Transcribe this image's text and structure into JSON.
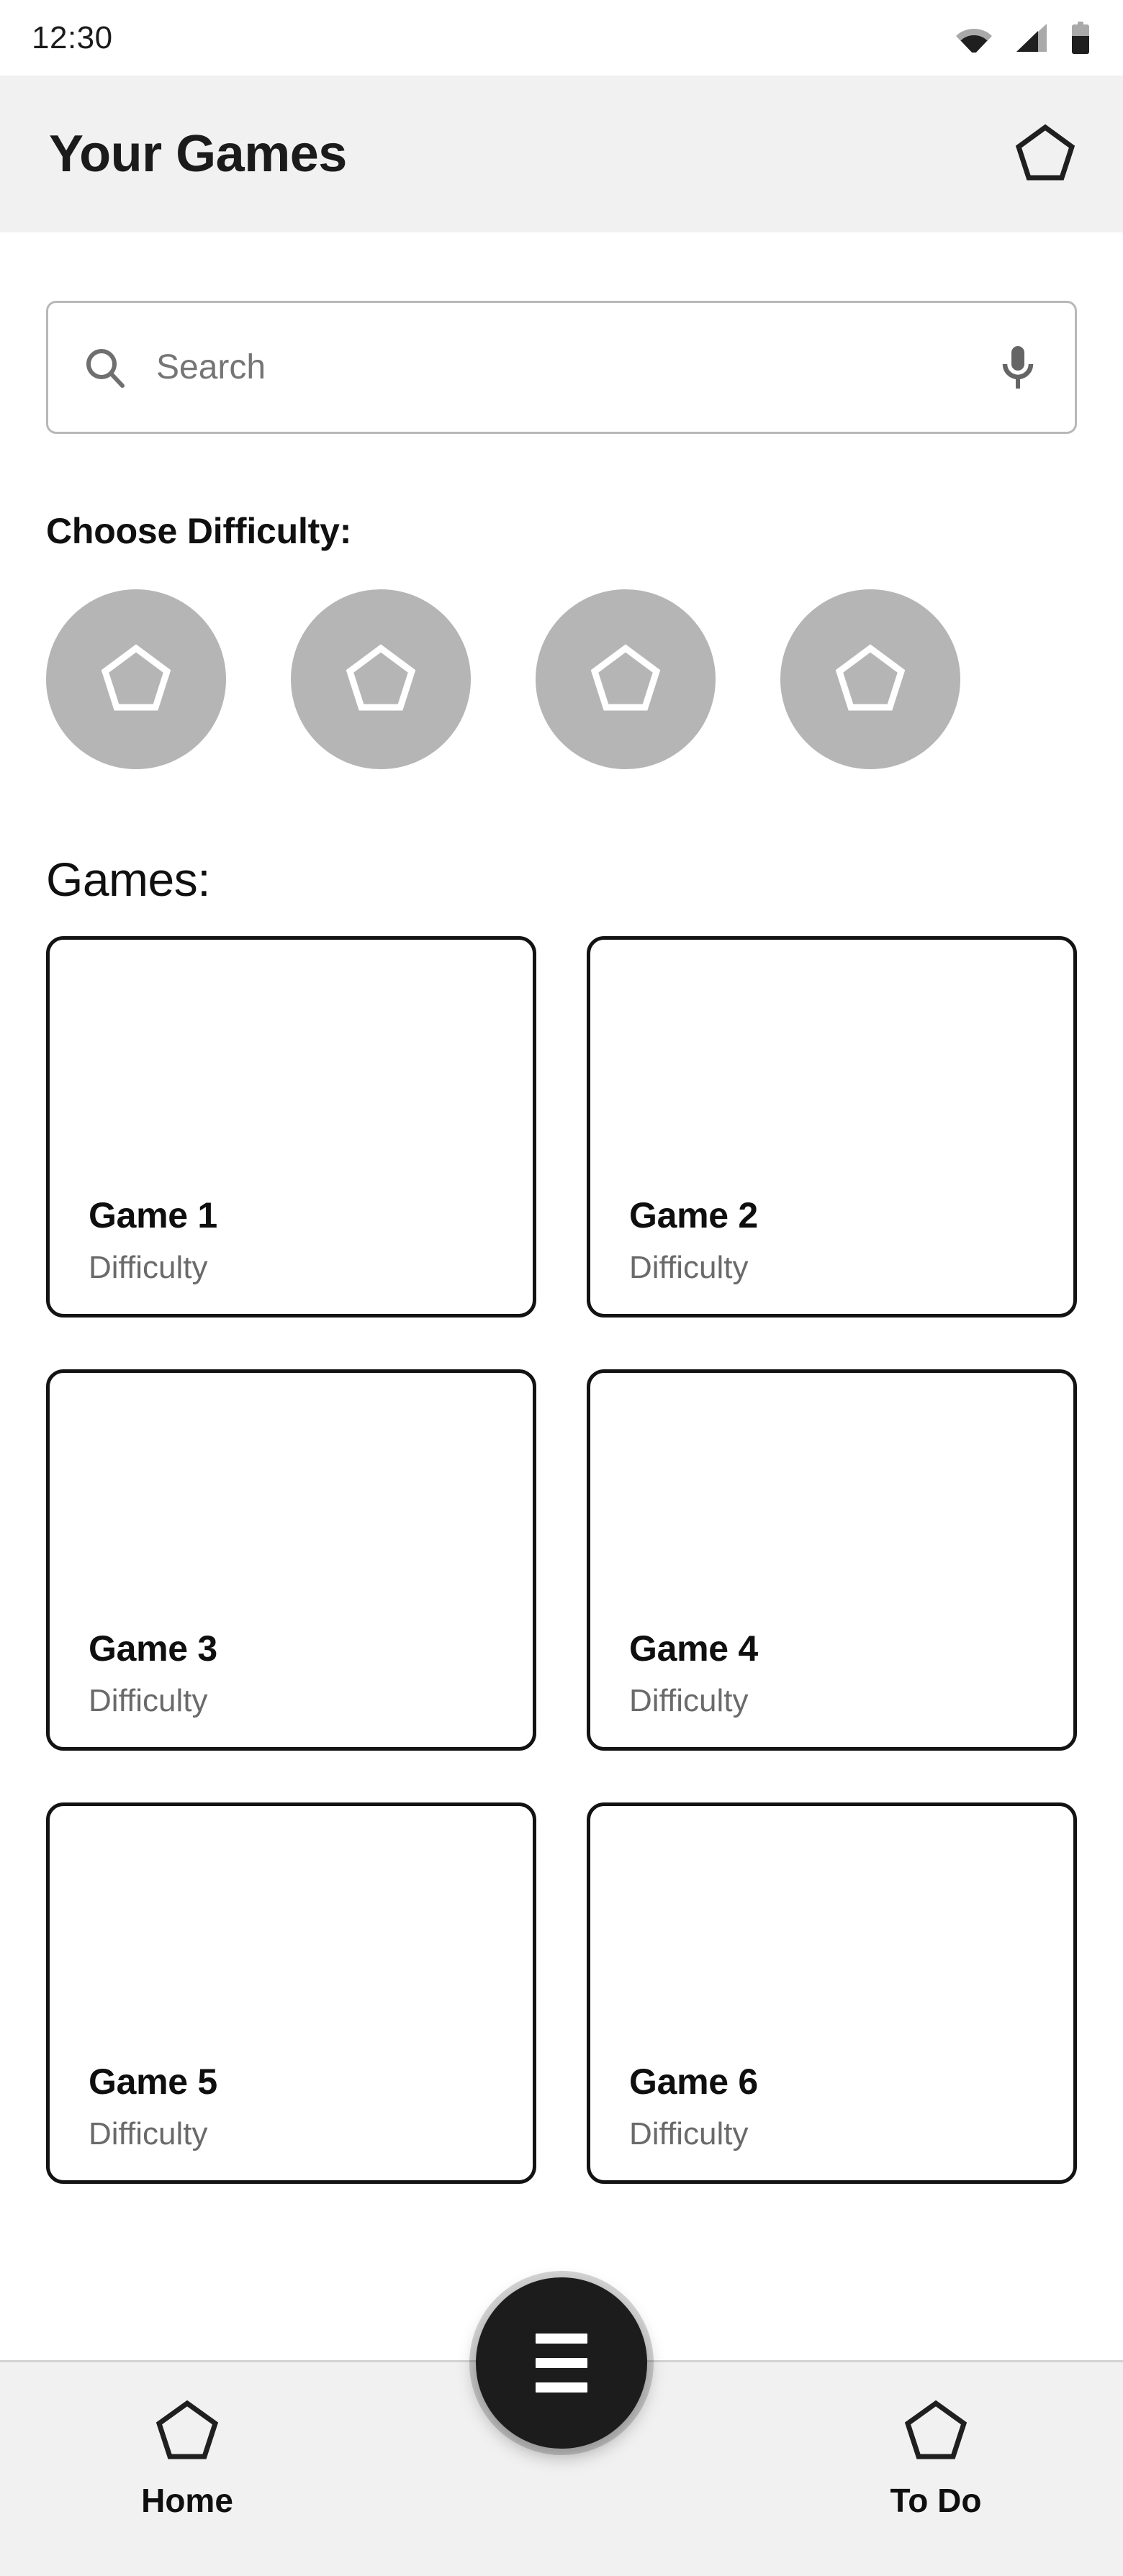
{
  "status_bar": {
    "time": "12:30",
    "icons": [
      "wifi-icon",
      "cellular-signal-icon",
      "battery-icon"
    ],
    "battery_level_pct": 60,
    "wifi_level": "partial",
    "signal_level": "partial"
  },
  "app_bar": {
    "title": "Your Games",
    "action_icon": "pentagon-icon"
  },
  "search": {
    "placeholder": "Search",
    "value": "",
    "leading_icon": "search-icon",
    "trailing_icon": "microphone-icon"
  },
  "difficulty": {
    "label": "Choose Difficulty:",
    "chips": [
      {
        "icon": "pentagon-icon"
      },
      {
        "icon": "pentagon-icon"
      },
      {
        "icon": "pentagon-icon"
      },
      {
        "icon": "pentagon-icon"
      }
    ],
    "chip_color": "#b5b5b5",
    "chip_icon_color": "#ffffff"
  },
  "games_section": {
    "label": "Games:",
    "cards": [
      {
        "title": "Game 1",
        "subtitle": "Difficulty"
      },
      {
        "title": "Game 2",
        "subtitle": "Difficulty"
      },
      {
        "title": "Game 3",
        "subtitle": "Difficulty"
      },
      {
        "title": "Game 4",
        "subtitle": "Difficulty"
      },
      {
        "title": "Game 5",
        "subtitle": "Difficulty"
      },
      {
        "title": "Game 6",
        "subtitle": "Difficulty"
      }
    ]
  },
  "bottom_nav": {
    "items": [
      {
        "label": "Home",
        "icon": "pentagon-icon"
      },
      {
        "label": "To Do",
        "icon": "pentagon-icon"
      }
    ],
    "fab": {
      "icon": "hamburger-menu-icon",
      "color": "#1c1c1c"
    }
  },
  "colors": {
    "app_bar_bg": "#f1f1f1",
    "page_bg": "#ffffff",
    "text_primary": "#101010",
    "text_secondary": "#6a6a6a",
    "card_border": "#131313",
    "chip_gray": "#b5b5b5"
  }
}
